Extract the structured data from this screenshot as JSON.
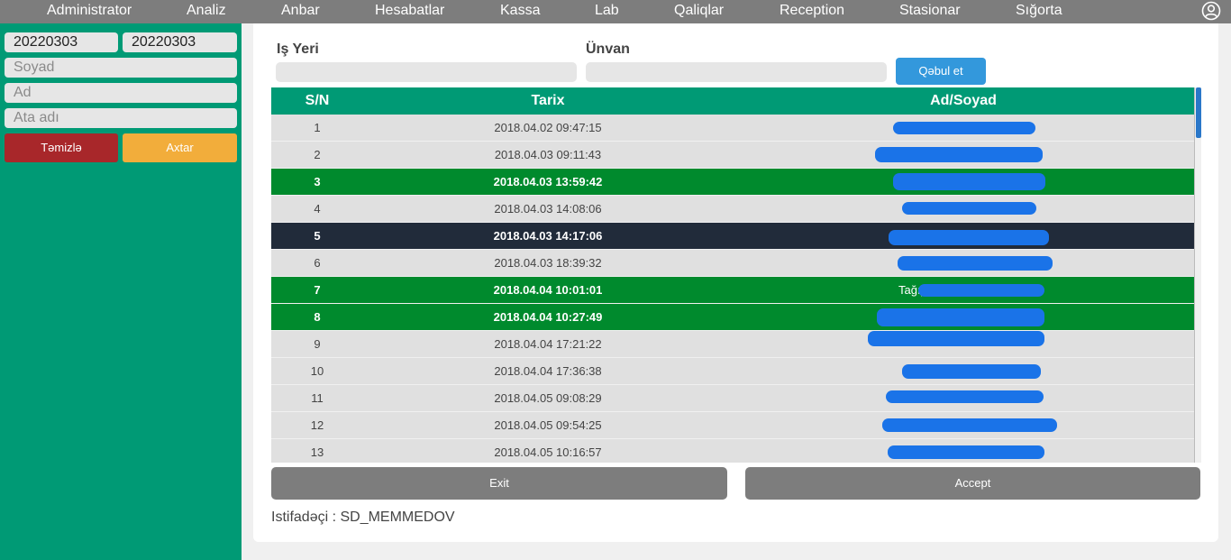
{
  "nav": {
    "items": [
      "Administrator",
      "Analiz",
      "Anbar",
      "Hesabatlar",
      "Kassa",
      "Lab",
      "Qaliqlar",
      "Reception",
      "Stasionar",
      "Sığorta"
    ],
    "user_icon": "user-circle-icon"
  },
  "sidebar": {
    "date_from": "20220303",
    "date_to": "20220303",
    "surname_placeholder": "Soyad",
    "name_placeholder": "Ad",
    "patronymic_placeholder": "Ata adı",
    "clear_label": "Təmizlə",
    "search_label": "Axtar"
  },
  "filters": {
    "workplace_label": "Iş Yeri",
    "address_label": "Ünvan",
    "accept_label": "Qəbul et"
  },
  "table": {
    "headers": [
      "S/N",
      "Tarix",
      "Ad/Soyad"
    ],
    "rows": [
      {
        "sn": "1",
        "date": "2018.04.02 09:47:15",
        "name": "",
        "style": "normal"
      },
      {
        "sn": "2",
        "date": "2018.04.03 09:11:43",
        "name": "",
        "style": "normal"
      },
      {
        "sn": "3",
        "date": "2018.04.03 13:59:42",
        "name": "",
        "style": "green"
      },
      {
        "sn": "4",
        "date": "2018.04.03 14:08:06",
        "name": "",
        "style": "normal"
      },
      {
        "sn": "5",
        "date": "2018.04.03 14:17:06",
        "name": "",
        "style": "dark"
      },
      {
        "sn": "6",
        "date": "2018.04.03 18:39:32",
        "name": "",
        "style": "normal"
      },
      {
        "sn": "7",
        "date": "2018.04.04 10:01:01",
        "name": "Tağıyeva",
        "style": "green"
      },
      {
        "sn": "8",
        "date": "2018.04.04 10:27:49",
        "name": "",
        "style": "green"
      },
      {
        "sn": "9",
        "date": "2018.04.04 17:21:22",
        "name": "",
        "style": "normal"
      },
      {
        "sn": "10",
        "date": "2018.04.04 17:36:38",
        "name": "",
        "style": "normal"
      },
      {
        "sn": "11",
        "date": "2018.04.05 09:08:29",
        "name": "",
        "style": "normal"
      },
      {
        "sn": "12",
        "date": "2018.04.05 09:54:25",
        "name": "",
        "style": "normal"
      },
      {
        "sn": "13",
        "date": "2018.04.05 10:16:57",
        "name": "",
        "style": "normal"
      }
    ]
  },
  "footer": {
    "exit_label": "Exit",
    "accept_label": "Accept",
    "user_text": "Istifadəçi : SD_MEMMEDOV"
  },
  "colors": {
    "accent_green": "#009a75",
    "row_green": "#008a2d",
    "row_selected": "#212b3a",
    "redaction": "#1a73e8"
  }
}
